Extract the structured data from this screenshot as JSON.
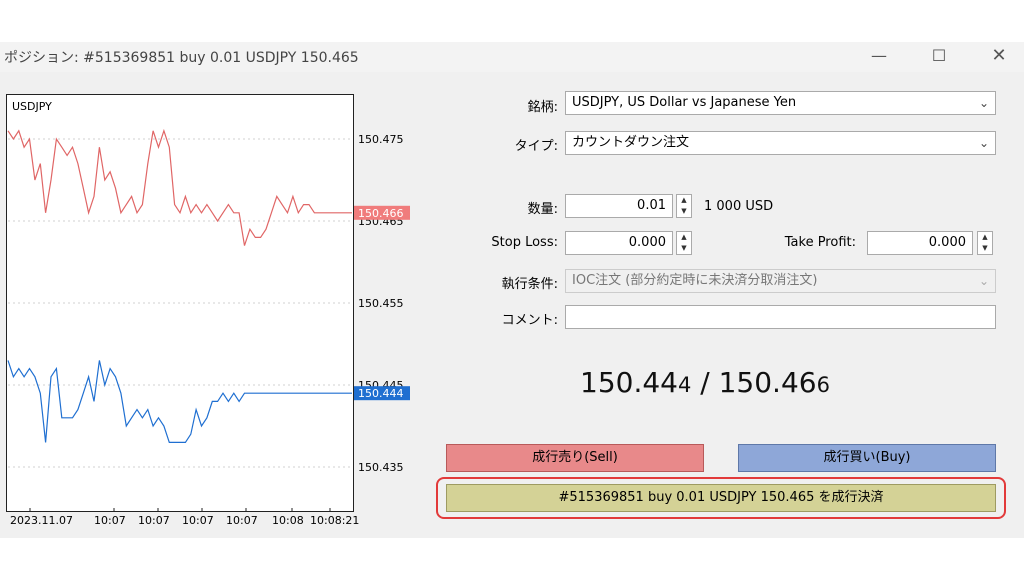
{
  "window": {
    "title": "ポジション: #515369851 buy 0.01 USDJPY 150.465",
    "minimize_icon": "minimize-icon",
    "maximize_icon": "maximize-icon",
    "close_icon": "close-icon"
  },
  "chart": {
    "symbol": "USDJPY",
    "price_ticks": [
      "150.475",
      "150.465",
      "150.455",
      "150.445",
      "150.435"
    ],
    "bid_marker": "150.466",
    "ask_marker": "150.444",
    "time_ticks": [
      "2023.11.07",
      "10:07",
      "10:07",
      "10:07",
      "10:07",
      "10:08",
      "10:08:21"
    ],
    "colors": {
      "bid_line": "#e06666",
      "ask_line": "#1f6fd1",
      "bid_tag": "#f07c7c",
      "ask_tag": "#1f6fd1"
    },
    "chart_data": {
      "type": "line",
      "ylim": [
        150.43,
        150.48
      ],
      "series": [
        {
          "values": [
            150.476,
            150.475,
            150.476,
            150.474,
            150.475,
            150.47,
            150.472,
            150.466,
            150.47,
            150.475,
            150.474,
            150.473,
            150.474,
            150.472,
            150.469,
            150.466,
            150.468,
            150.474,
            150.47,
            150.471,
            150.469,
            150.466,
            150.467,
            150.468,
            150.466,
            150.467,
            150.472,
            150.476,
            150.474,
            150.476,
            150.474,
            150.467,
            150.466,
            150.468,
            150.466,
            150.467,
            150.466,
            150.467,
            150.466,
            150.465,
            150.466,
            150.467,
            150.466,
            150.466,
            150.462,
            150.464,
            150.463,
            150.463,
            150.464,
            150.466,
            150.468,
            150.467,
            150.466,
            150.468,
            150.466,
            150.467,
            150.467,
            150.466,
            150.466,
            150.466,
            150.466,
            150.466,
            150.466,
            150.466,
            150.466
          ]
        },
        {
          "values": [
            150.448,
            150.446,
            150.447,
            150.446,
            150.447,
            150.446,
            150.444,
            150.438,
            150.446,
            150.447,
            150.441,
            150.441,
            150.441,
            150.442,
            150.444,
            150.446,
            150.443,
            150.448,
            150.445,
            150.447,
            150.446,
            150.444,
            150.44,
            150.441,
            150.442,
            150.441,
            150.442,
            150.44,
            150.441,
            150.44,
            150.438,
            150.438,
            150.438,
            150.438,
            150.439,
            150.442,
            150.44,
            150.441,
            150.443,
            150.443,
            150.444,
            150.443,
            150.444,
            150.443,
            150.444,
            150.444,
            150.444,
            150.444,
            150.444,
            150.444,
            150.444,
            150.444,
            150.444,
            150.444,
            150.444,
            150.444,
            150.444,
            150.444,
            150.444,
            150.444,
            150.444,
            150.444,
            150.444,
            150.444,
            150.444
          ]
        }
      ]
    }
  },
  "form": {
    "symbol_label": "銘柄:",
    "symbol_value": "USDJPY, US Dollar vs Japanese Yen",
    "type_label": "タイプ:",
    "type_value": "カウントダウン注文",
    "volume_label": "数量:",
    "volume_value": "0.01",
    "volume_unit": "1 000 USD",
    "sl_label": "Stop Loss:",
    "sl_value": "0.000",
    "tp_label": "Take Profit:",
    "tp_value": "0.000",
    "fill_label": "執行条件:",
    "fill_value": "IOC注文 (部分約定時に未決済分取消注文)",
    "comment_label": "コメント:",
    "comment_value": ""
  },
  "quote": {
    "bid_main": "150.44",
    "bid_small": "4",
    "separator": " / ",
    "ask_main": "150.46",
    "ask_small": "6"
  },
  "buttons": {
    "sell": "成行売り(Sell)",
    "buy": "成行買い(Buy)",
    "close": "#515369851 buy 0.01 USDJPY 150.465 を成行決済"
  }
}
